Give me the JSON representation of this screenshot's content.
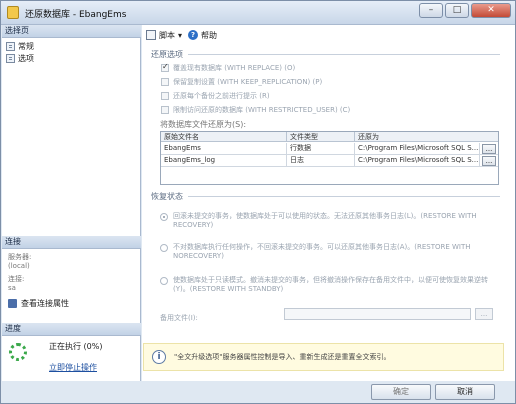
{
  "window": {
    "title": "还原数据库 - EbangEms",
    "buttons": {
      "minimize": "–",
      "maximize": "□",
      "close": "✕"
    }
  },
  "left": {
    "select_page_header": "选择页",
    "nav_items": [
      {
        "label": "常规",
        "icon": "page-icon"
      },
      {
        "label": "选项",
        "icon": "page-icon"
      }
    ],
    "connection_header": "连接",
    "server_label": "服务器:",
    "server_value": "(local)",
    "connection_label": "连接:",
    "connection_value": "sa",
    "view_conn_props": "查看连接属性",
    "progress_header": "进度",
    "progress_status": "正在执行 (0%)",
    "stop_action": "立即停止操作"
  },
  "toolbar": {
    "script_label": "脚本",
    "dropdown_glyph": "▾",
    "help_label": "帮助"
  },
  "restore_options": {
    "group_label": "还原选项",
    "options": [
      {
        "label": "覆盖现有数据库 (WITH REPLACE) (O)",
        "checked": true
      },
      {
        "label": "保留复制设置 (WITH KEEP_REPLICATION) (P)",
        "checked": false
      },
      {
        "label": "还原每个备份之前进行提示 (R)",
        "checked": false
      },
      {
        "label": "限制访问还原的数据库 (WITH RESTRICTED_USER) (C)",
        "checked": false
      }
    ],
    "restore_files_as_label": "将数据库文件还原为(S):",
    "table": {
      "headers": [
        "原始文件名",
        "文件类型",
        "还原为"
      ],
      "rows": [
        [
          "EbangEms",
          "行数据",
          "C:\\Program Files\\Microsoft SQL S..."
        ],
        [
          "EbangEms_log",
          "日志",
          "C:\\Program Files\\Microsoft SQL S..."
        ]
      ],
      "browse_glyph": "..."
    }
  },
  "recovery_state": {
    "group_label": "恢复状态",
    "options": [
      {
        "label": "回滚未提交的事务，使数据库处于可以使用的状态。无法还原其他事务日志(L)。(RESTORE WITH RECOVERY)",
        "selected": true
      },
      {
        "label": "不对数据库执行任何操作，不回滚未提交的事务。可以还原其他事务日志(A)。(RESTORE WITH NORECOVERY)",
        "selected": false
      },
      {
        "label": "使数据库处于只读模式。撤消未提交的事务，但将撤消操作保存在备用文件中，以便可使恢复效果逆转(Y)。(RESTORE WITH STANDBY)",
        "selected": false
      }
    ],
    "standby_file_label": "备用文件(I):",
    "standby_file_value": "",
    "standby_browse_glyph": "..."
  },
  "info": {
    "icon_glyph": "i",
    "text": "\"全文升级选项\"服务器属性控制是导入、重新生成还是重置全文索引。"
  },
  "buttons": {
    "ok": "确定",
    "cancel": "取消"
  }
}
